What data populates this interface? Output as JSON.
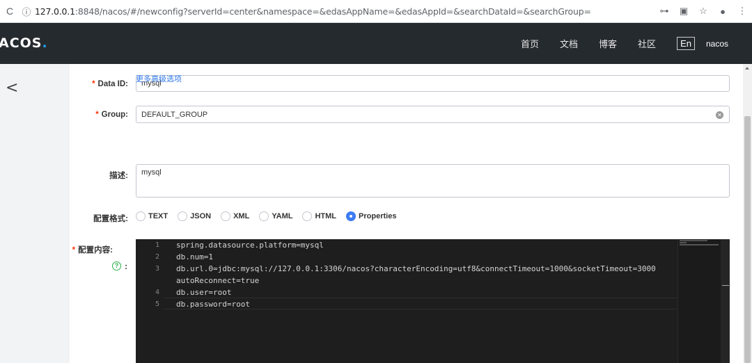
{
  "browser": {
    "url_host": "127.0.0.1",
    "url_rest": ":8848/nacos/#/newconfig?serverId=center&namespace=&edasAppName=&edasAppId=&searchDataId=&searchGroup="
  },
  "header": {
    "logo_text": "ACOS",
    "logo_dot": ".",
    "nav": [
      "首页",
      "文档",
      "博客",
      "社区"
    ],
    "lang": "En",
    "user": "nacos"
  },
  "form": {
    "data_id_label": "Data ID:",
    "data_id_value": "mysql",
    "group_label": "Group:",
    "group_value": "DEFAULT_GROUP",
    "advanced_link": "更多高级选项",
    "desc_label": "描述:",
    "desc_value": "mysql",
    "format_label": "配置格式:",
    "formats": [
      "TEXT",
      "JSON",
      "XML",
      "YAML",
      "HTML",
      "Properties"
    ],
    "selected_format": "Properties",
    "content_label": "配置内容:",
    "help_colon": ":"
  },
  "editor": {
    "line_numbers": [
      "1",
      "2",
      "3",
      "",
      "4",
      "5"
    ],
    "lines": [
      "spring.datasource.platform=mysql",
      "db.num=1",
      "db.url.0=jdbc:mysql://127.0.0.1:3306/nacos?characterEncoding=utf8&connectTimeout=1000&socketTimeout=3000",
      "autoReconnect=true",
      "db.user=root",
      "db.password=root"
    ]
  },
  "colors": {
    "nav_bg": "#252a2f",
    "accent": "#3c7bf2",
    "required": "#ff3000",
    "editor_bg": "#1e1e1e"
  }
}
